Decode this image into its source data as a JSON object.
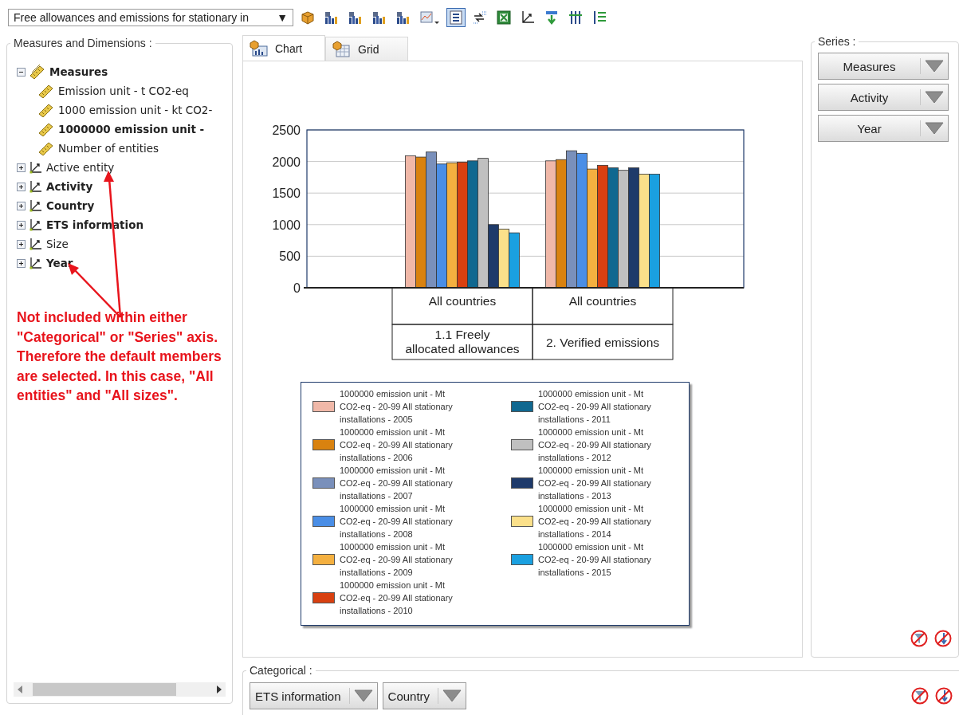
{
  "toolbar": {
    "report_select": {
      "value": "Free allowances and emissions for stationary in",
      "arrow": "▼"
    },
    "buttons": [
      {
        "kind": "cube",
        "selected": false
      },
      {
        "kind": "bar-chart",
        "selected": false
      },
      {
        "kind": "bar-chart",
        "selected": false
      },
      {
        "kind": "bar-chart",
        "selected": false
      },
      {
        "kind": "bar-chart",
        "selected": false
      },
      {
        "kind": "chart-wizard",
        "selected": false
      },
      {
        "kind": "list",
        "selected": true
      },
      {
        "kind": "swap",
        "selected": false
      },
      {
        "kind": "spreadsheet",
        "selected": false
      },
      {
        "kind": "axes",
        "selected": false
      },
      {
        "kind": "export",
        "selected": false
      },
      {
        "kind": "columns",
        "selected": false
      },
      {
        "kind": "rows",
        "selected": false
      }
    ]
  },
  "tree": {
    "title": "Measures and Dimensions :",
    "items": [
      {
        "label": "Measures",
        "kind": "measure-group",
        "in_use": true,
        "expanded": true,
        "children": [
          {
            "label": "Emission unit - t CO2-eq",
            "kind": "measure",
            "in_use": false
          },
          {
            "label": "1000 emission unit - kt CO2-",
            "kind": "measure",
            "in_use": false
          },
          {
            "label": "1000000 emission unit -",
            "kind": "measure",
            "in_use": true
          },
          {
            "label": "Number of entities",
            "kind": "measure",
            "in_use": false
          }
        ]
      },
      {
        "label": "Active entity",
        "kind": "dimension",
        "in_use": false,
        "expanded": false
      },
      {
        "label": "Activity",
        "kind": "dimension",
        "in_use": true,
        "expanded": false
      },
      {
        "label": "Country",
        "kind": "dimension",
        "in_use": true,
        "expanded": false
      },
      {
        "label": "ETS information",
        "kind": "dimension",
        "in_use": true,
        "expanded": false
      },
      {
        "label": "Size",
        "kind": "dimension",
        "in_use": false,
        "expanded": false
      },
      {
        "label": "Year",
        "kind": "dimension",
        "in_use": true,
        "expanded": false
      }
    ]
  },
  "annotation": {
    "text": "Not included within either \"Categorical\" or \"Series\" axis. Therefore the default members are selected. In this case, \"All entities\" and \"All sizes\"."
  },
  "tabs": [
    {
      "label": "Chart",
      "kind": "chart",
      "selected": true
    },
    {
      "label": "Grid",
      "kind": "grid",
      "selected": false
    }
  ],
  "chart": {
    "axis_table": {
      "group_labels": [
        "All countries",
        "All countries"
      ]
    },
    "chart_data": {
      "type": "bar",
      "grid": true,
      "legend": true,
      "categories": [
        "1.1 Freely allocated allowances",
        "2. Verified emissions"
      ],
      "ylim": [
        0,
        2500
      ],
      "yticks": [
        0,
        500,
        1000,
        1500,
        2000,
        2500
      ],
      "series": [
        {
          "name": "1000000 emission unit - Mt CO2-eq - 20-99 All stationary installations - 2005",
          "color": "#f0b8a8",
          "values": [
            2090,
            2010
          ]
        },
        {
          "name": "1000000 emission unit - Mt CO2-eq - 20-99 All stationary installations - 2006",
          "color": "#d9820f",
          "values": [
            2070,
            2030
          ]
        },
        {
          "name": "1000000 emission unit - Mt CO2-eq - 20-99 All stationary installations - 2007",
          "color": "#7a90bb",
          "values": [
            2150,
            2170
          ]
        },
        {
          "name": "1000000 emission unit - Mt CO2-eq - 20-99 All stationary installations - 2008",
          "color": "#4a8ee6",
          "values": [
            1960,
            2130
          ]
        },
        {
          "name": "1000000 emission unit - Mt CO2-eq - 20-99 All stationary installations - 2009",
          "color": "#f4b040",
          "values": [
            1980,
            1880
          ]
        },
        {
          "name": "1000000 emission unit - Mt CO2-eq - 20-99 All stationary installations - 2010",
          "color": "#d84010",
          "values": [
            1990,
            1940
          ]
        },
        {
          "name": "1000000 emission unit - Mt CO2-eq - 20-99 All stationary installations - 2011",
          "color": "#106890",
          "values": [
            2010,
            1900
          ]
        },
        {
          "name": "1000000 emission unit - Mt CO2-eq - 20-99 All stationary installations - 2012",
          "color": "#c0c0c0",
          "values": [
            2050,
            1860
          ]
        },
        {
          "name": "1000000 emission unit - Mt CO2-eq - 20-99 All stationary installations - 2013",
          "color": "#1e3a6a",
          "values": [
            1000,
            1900
          ]
        },
        {
          "name": "1000000 emission unit - Mt CO2-eq - 20-99 All stationary installations - 2014",
          "color": "#fbe08a",
          "values": [
            930,
            1800
          ]
        },
        {
          "name": "1000000 emission unit - Mt CO2-eq - 20-99 All stationary installations - 2015",
          "color": "#1aa0e0",
          "values": [
            870,
            1800
          ]
        }
      ]
    }
  },
  "series_panel": {
    "title": "Series :",
    "fields": [
      {
        "label": "Measures"
      },
      {
        "label": "Activity"
      },
      {
        "label": "Year"
      }
    ]
  },
  "categorical_panel": {
    "title": "Categorical :",
    "fields": [
      {
        "label": "ETS information"
      },
      {
        "label": "Country"
      }
    ]
  }
}
